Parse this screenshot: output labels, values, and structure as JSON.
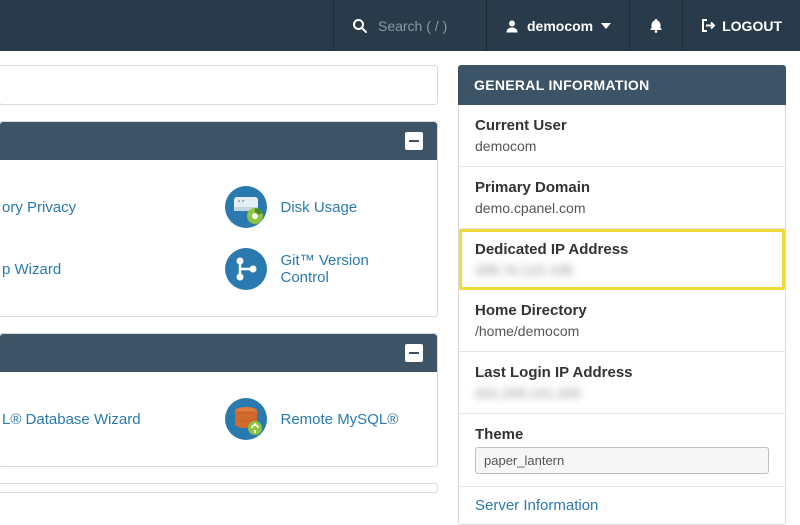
{
  "topbar": {
    "search_placeholder": "Search ( / )",
    "username": "democom",
    "logout": "LOGOUT"
  },
  "left": {
    "panel1": {
      "items": [
        {
          "label": "ory Privacy"
        },
        {
          "label": "Disk Usage"
        },
        {
          "label": "p Wizard"
        },
        {
          "label": "Git™ Version Control"
        }
      ]
    },
    "panel2": {
      "items": [
        {
          "label": "L® Database Wizard"
        },
        {
          "label": "Remote MySQL®"
        }
      ]
    }
  },
  "sidebar": {
    "title": "GENERAL INFORMATION",
    "current_user_label": "Current User",
    "current_user": "democom",
    "primary_domain_label": "Primary Domain",
    "primary_domain": "demo.cpanel.com",
    "dedicated_ip_label": "Dedicated IP Address",
    "dedicated_ip": "208.74.122.108",
    "home_dir_label": "Home Directory",
    "home_dir": "/home/democom",
    "last_login_label": "Last Login IP Address",
    "last_login": "201.209.141.209",
    "theme_label": "Theme",
    "theme_value": "paper_lantern",
    "server_info": "Server Information"
  }
}
